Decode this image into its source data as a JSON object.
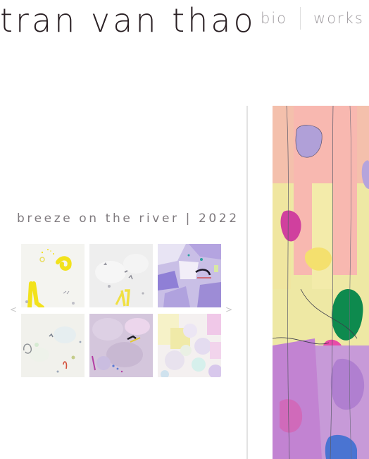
{
  "site": {
    "title": "tran van thao"
  },
  "nav": {
    "items": [
      "bio",
      "works"
    ]
  },
  "series": {
    "title": "breeze on the river | 2022"
  },
  "gallery": {
    "prev_arrow": "<",
    "next_arrow": ">",
    "thumbnails": [
      {
        "palette": {
          "base": "#f4f4f0",
          "accent": "#f2e21c"
        }
      },
      {
        "palette": {
          "base": "#eeeeee",
          "accent": "#f0e042"
        }
      },
      {
        "palette": {
          "base": "#c9bfe6",
          "accent": "#8f7fd6"
        }
      },
      {
        "palette": {
          "base": "#f1f1ec",
          "accent": "#d6ead2"
        }
      },
      {
        "palette": {
          "base": "#d4c6dc",
          "accent": "#ecd6ec"
        }
      },
      {
        "palette": {
          "base": "#f4f0f0",
          "accent": "#f0eaa8"
        }
      }
    ]
  },
  "colors": {
    "title_text": "#2a2024",
    "nav_text": "#a09ca0",
    "series_text": "#7f7a7e",
    "divider": "#e3e3e3"
  }
}
